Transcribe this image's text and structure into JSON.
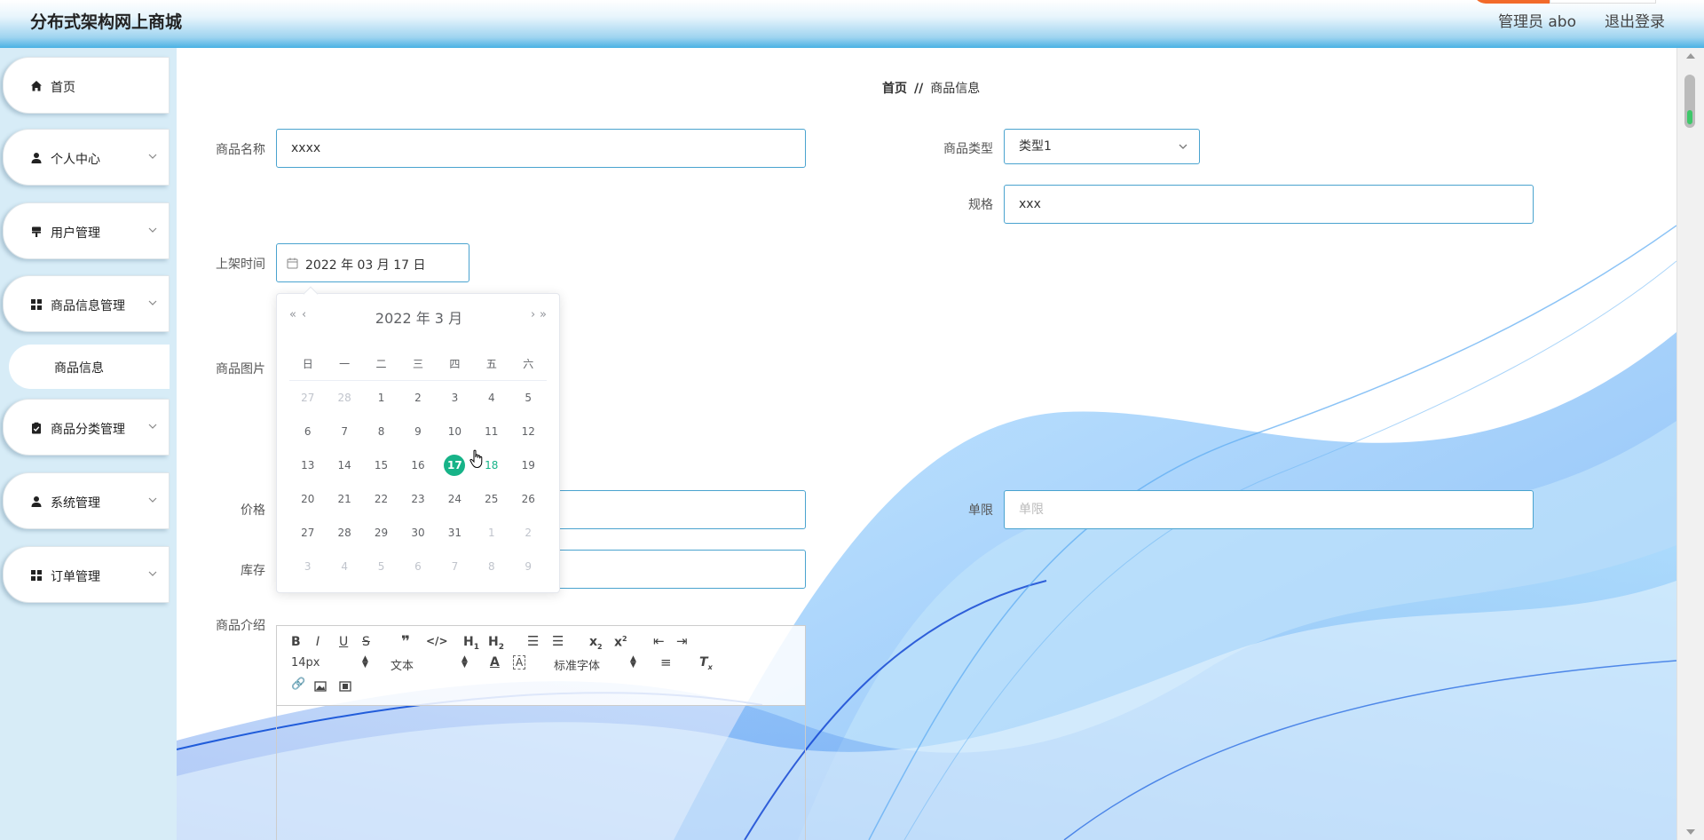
{
  "header": {
    "app_title": "分布式架构网上商城",
    "user_label": "管理员 abo",
    "logout_label": "退出登录"
  },
  "sidebar": {
    "items": [
      {
        "label": "首页",
        "icon": "home-icon"
      },
      {
        "label": "个人中心",
        "icon": "person-icon"
      },
      {
        "label": "用户管理",
        "icon": "user-manage-icon"
      },
      {
        "label": "商品信息管理",
        "icon": "grid-icon"
      },
      {
        "label": "商品分类管理",
        "icon": "clipboard-icon"
      },
      {
        "label": "系统管理",
        "icon": "person-icon"
      },
      {
        "label": "订单管理",
        "icon": "grid-icon"
      }
    ],
    "sub_item": "商品信息"
  },
  "breadcrumb": {
    "home": "首页",
    "separator": "//",
    "current": "商品信息"
  },
  "form": {
    "name_label": "商品名称",
    "name_value": "xxxx",
    "type_label": "商品类型",
    "type_value": "类型1",
    "spec_label": "规格",
    "spec_value": "xxx",
    "date_label": "上架时间",
    "date_value": "2022 年 03 月 17 日",
    "image_label": "商品图片",
    "price_label": "价格",
    "limit_label": "单限",
    "limit_placeholder": "单限",
    "stock_label": "库存",
    "intro_label": "商品介绍"
  },
  "datepicker": {
    "header": "2022 年  3 月",
    "prev_year": "«",
    "prev_month": "‹",
    "next_month": "›",
    "next_year": "»",
    "weekdays": [
      "日",
      "一",
      "二",
      "三",
      "四",
      "五",
      "六"
    ],
    "selected_day": "17",
    "today_day": "18",
    "weeks": [
      [
        "27",
        "28",
        "1",
        "2",
        "3",
        "4",
        "5"
      ],
      [
        "6",
        "7",
        "8",
        "9",
        "10",
        "11",
        "12"
      ],
      [
        "13",
        "14",
        "15",
        "16",
        "17",
        "18",
        "19"
      ],
      [
        "20",
        "21",
        "22",
        "23",
        "24",
        "25",
        "26"
      ],
      [
        "27",
        "28",
        "29",
        "30",
        "31",
        "1",
        "2"
      ],
      [
        "3",
        "4",
        "5",
        "6",
        "7",
        "8",
        "9"
      ]
    ]
  },
  "editor": {
    "font_size": "14px",
    "block_type": "文本",
    "font_family": "标准字体"
  },
  "colors": {
    "accent": "#17b388",
    "input_border": "#4aa3cf",
    "header_blue": "#49b1e4",
    "sidebar_bg": "#d7ecf7"
  }
}
